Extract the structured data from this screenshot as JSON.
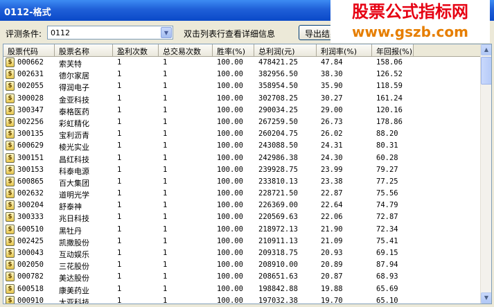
{
  "window": {
    "title": "0112-格式"
  },
  "watermark": {
    "line1": "股票公式指标网",
    "line2": "www.gszb.com"
  },
  "toolbar": {
    "condition_label": "评测条件:",
    "condition_value": "0112",
    "hint": "双击列表行查看详细信息",
    "export_label": "导出结果"
  },
  "columns": [
    "股票代码",
    "股票名称",
    "盈利次数",
    "总交易次数",
    "胜率(%)",
    "总利润(元)",
    "利润率(%)",
    "年回报(%)"
  ],
  "rows": [
    [
      "000662",
      "索芙特",
      "1",
      "1",
      "100.00",
      "478421.25",
      "47.84",
      "158.06"
    ],
    [
      "002631",
      "德尔家居",
      "1",
      "1",
      "100.00",
      "382956.50",
      "38.30",
      "126.52"
    ],
    [
      "002055",
      "得润电子",
      "1",
      "1",
      "100.00",
      "358954.50",
      "35.90",
      "118.59"
    ],
    [
      "300028",
      "金亚科技",
      "1",
      "1",
      "100.00",
      "302708.25",
      "30.27",
      "161.24"
    ],
    [
      "300347",
      "泰格医药",
      "1",
      "1",
      "100.00",
      "290034.25",
      "29.00",
      "120.16"
    ],
    [
      "002256",
      "彩虹精化",
      "1",
      "1",
      "100.00",
      "267259.50",
      "26.73",
      "178.86"
    ],
    [
      "300135",
      "宝利沥青",
      "1",
      "1",
      "100.00",
      "260204.75",
      "26.02",
      "88.20"
    ],
    [
      "600629",
      "棱光实业",
      "1",
      "1",
      "100.00",
      "243088.50",
      "24.31",
      "80.31"
    ],
    [
      "300151",
      "昌红科技",
      "1",
      "1",
      "100.00",
      "242986.38",
      "24.30",
      "60.28"
    ],
    [
      "300153",
      "科泰电源",
      "1",
      "1",
      "100.00",
      "239928.75",
      "23.99",
      "79.27"
    ],
    [
      "600865",
      "百大集团",
      "1",
      "1",
      "100.00",
      "233810.13",
      "23.38",
      "77.25"
    ],
    [
      "002632",
      "道明光学",
      "1",
      "1",
      "100.00",
      "228721.50",
      "22.87",
      "75.56"
    ],
    [
      "300204",
      "舒泰神",
      "1",
      "1",
      "100.00",
      "226369.00",
      "22.64",
      "74.79"
    ],
    [
      "300333",
      "兆日科技",
      "1",
      "1",
      "100.00",
      "220569.63",
      "22.06",
      "72.87"
    ],
    [
      "600510",
      "黑牡丹",
      "1",
      "1",
      "100.00",
      "218972.13",
      "21.90",
      "72.34"
    ],
    [
      "002425",
      "凯撒股份",
      "1",
      "1",
      "100.00",
      "210911.13",
      "21.09",
      "75.41"
    ],
    [
      "300043",
      "互动娱乐",
      "1",
      "1",
      "100.00",
      "209318.75",
      "20.93",
      "69.15"
    ],
    [
      "002050",
      "三花股份",
      "1",
      "1",
      "100.00",
      "208910.00",
      "20.89",
      "87.94"
    ],
    [
      "000782",
      "美达股份",
      "1",
      "1",
      "100.00",
      "208651.63",
      "20.87",
      "68.93"
    ],
    [
      "600518",
      "康美药业",
      "1",
      "1",
      "100.00",
      "198842.88",
      "19.88",
      "65.69"
    ],
    [
      "000910",
      "大亚科技",
      "1",
      "1",
      "100.00",
      "197032.38",
      "19.70",
      "65.10"
    ]
  ],
  "icons": {
    "row_icon": "dollar-icon",
    "combo_arrow": "chevron-down-icon"
  }
}
